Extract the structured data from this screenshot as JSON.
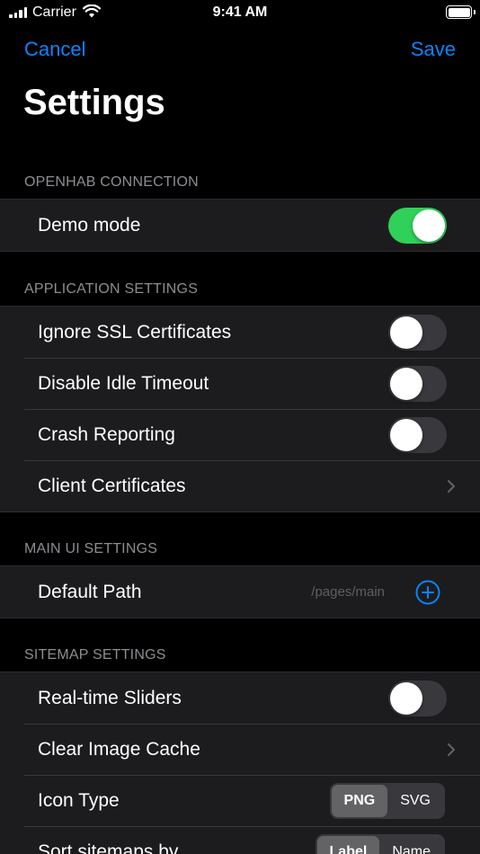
{
  "status_bar": {
    "carrier": "Carrier",
    "time": "9:41 AM"
  },
  "nav": {
    "cancel": "Cancel",
    "save": "Save",
    "title": "Settings"
  },
  "sections": {
    "openhab": {
      "header": "OPENHAB CONNECTION",
      "demo_mode": {
        "label": "Demo mode",
        "on": true
      }
    },
    "application": {
      "header": "APPLICATION SETTINGS",
      "ignore_ssl": {
        "label": "Ignore SSL Certificates",
        "on": false
      },
      "disable_idle": {
        "label": "Disable Idle Timeout",
        "on": false
      },
      "crash_reporting": {
        "label": "Crash Reporting",
        "on": false
      },
      "client_certs": {
        "label": "Client Certificates"
      }
    },
    "main_ui": {
      "header": "MAIN UI SETTINGS",
      "default_path": {
        "label": "Default Path",
        "placeholder": "/pages/main"
      }
    },
    "sitemap": {
      "header": "SITEMAP SETTINGS",
      "realtime_sliders": {
        "label": "Real-time Sliders",
        "on": false
      },
      "clear_cache": {
        "label": "Clear Image Cache"
      },
      "icon_type": {
        "label": "Icon Type",
        "options": [
          "PNG",
          "SVG"
        ],
        "selected": "PNG"
      },
      "sort_by": {
        "label": "Sort sitemaps by",
        "options": [
          "Label",
          "Name"
        ],
        "selected": "Label"
      }
    }
  },
  "colors": {
    "accent": "#0a84ff",
    "toggle_on": "#30d158",
    "background": "#000000",
    "cell": "#1c1c1e",
    "secondary_text": "#8d8d93"
  }
}
